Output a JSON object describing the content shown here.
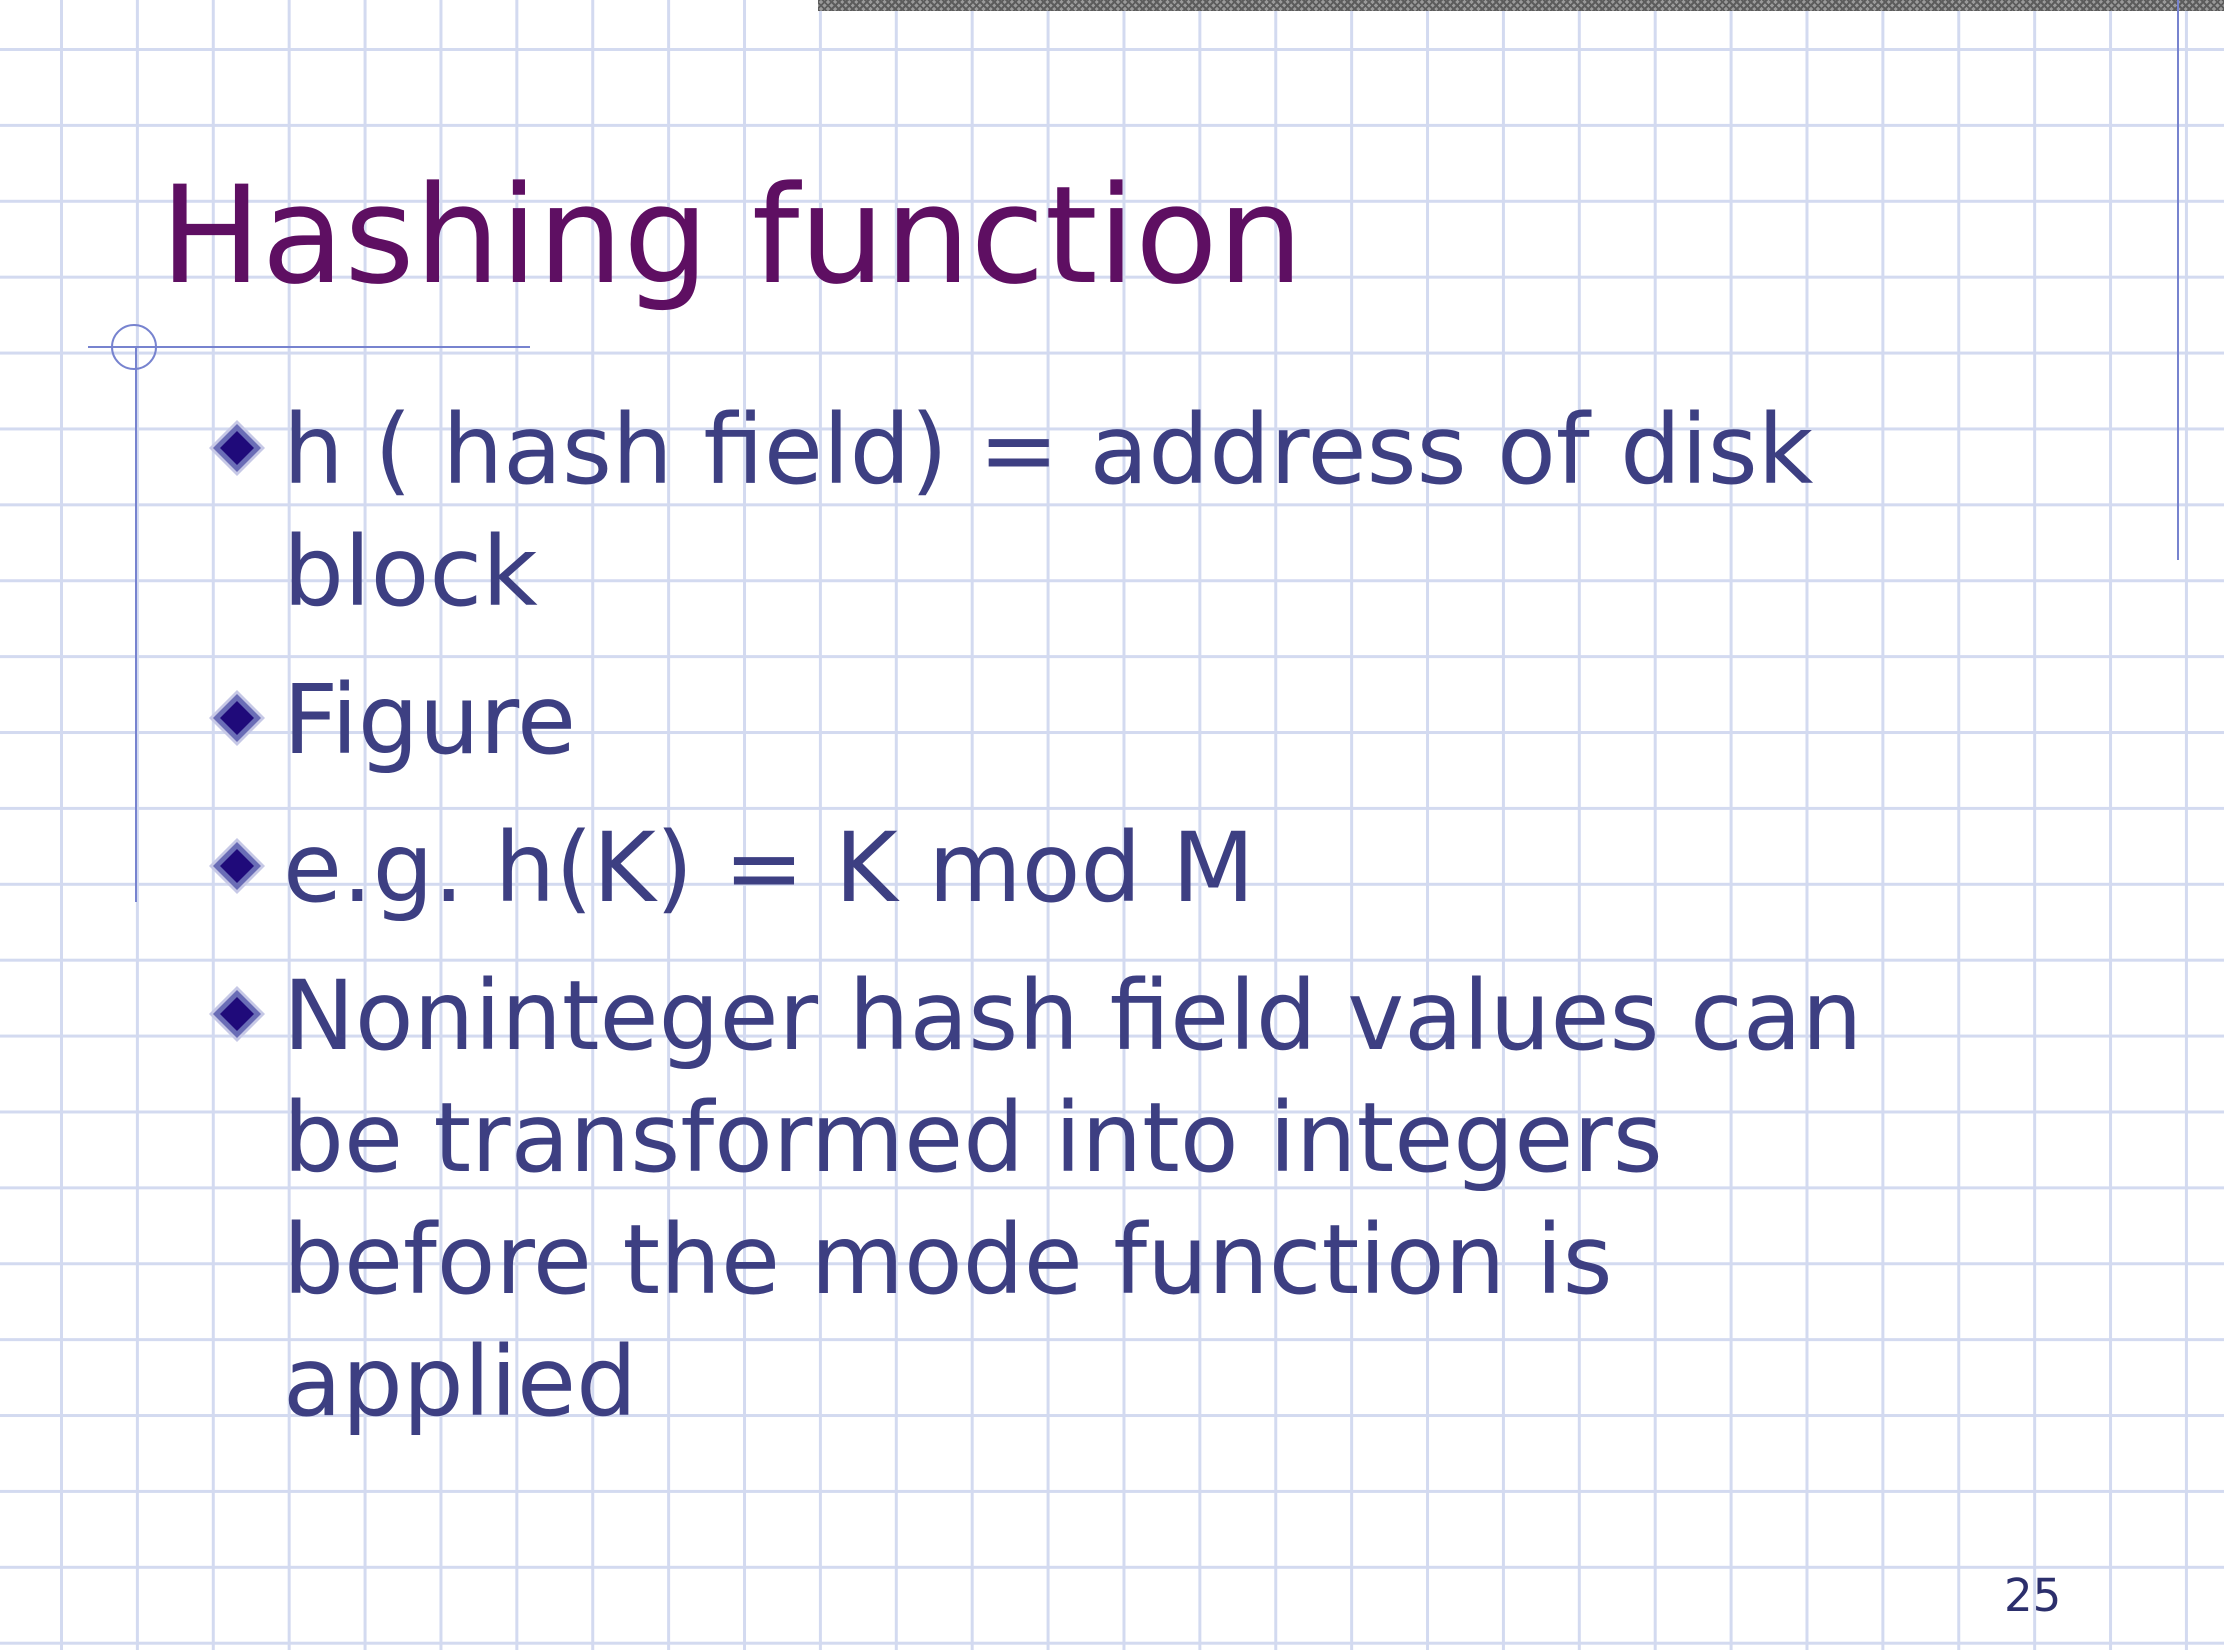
{
  "slide": {
    "title": "Hashing function",
    "bullets": [
      "h ( hash field) = address of disk block",
      "Figure",
      "e.g. h(K) = K mod M",
      "Noninteger hash field values can be transformed into integers before the mode function is applied"
    ],
    "page_number": "25"
  },
  "colors": {
    "title": "#5e0f62",
    "body_text": "#3d3f82",
    "grid": "#d3daf0",
    "accent_rule": "#7783cf",
    "bullet_fill": "#1f0a7a"
  },
  "icons": {
    "bullet": "diamond-bullet-icon"
  }
}
